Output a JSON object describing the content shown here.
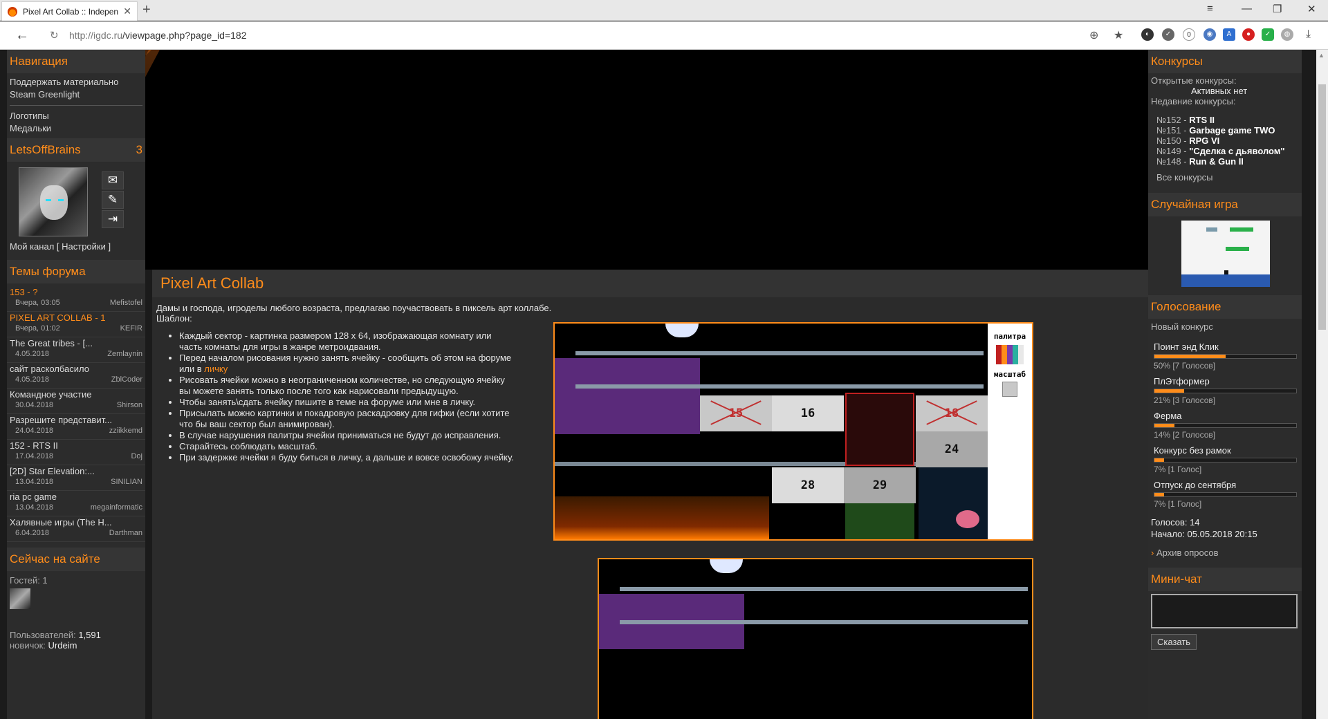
{
  "browser": {
    "tab_title": "Pixel Art Collab :: Indepen",
    "url_host": "http://igdc.ru",
    "url_path": "/viewpage.php?page_id=182",
    "ext_badge": "0"
  },
  "left": {
    "nav_title": "Навигация",
    "nav_links": [
      "Поддержать материально",
      "Steam Greenlight",
      "Логотипы",
      "Медальки"
    ],
    "user_name": "LetsOffBrains",
    "user_count": "3",
    "my_channel": "Мой канал",
    "settings": "[ Настройки ]",
    "forum_title": "Темы форума",
    "topics": [
      {
        "title": "153 - ?",
        "date": "Вчера, 03:05",
        "author": "Mefistofel",
        "hl": true
      },
      {
        "title": "PIXEL ART COLLAB - 1",
        "date": "Вчера, 01:02",
        "author": "KEFIR",
        "hl": true
      },
      {
        "title": "The Great tribes - [...",
        "date": "4.05.2018",
        "author": "Zemlaynin",
        "hl": false
      },
      {
        "title": "сайт расколбасило",
        "date": "4.05.2018",
        "author": "ZblCoder",
        "hl": false
      },
      {
        "title": "Командное участие",
        "date": "30.04.2018",
        "author": "Shirson",
        "hl": false
      },
      {
        "title": "Разрешите представит...",
        "date": "24.04.2018",
        "author": "zziikkemd",
        "hl": false
      },
      {
        "title": "152 - RTS II",
        "date": "17.04.2018",
        "author": "Doj",
        "hl": false
      },
      {
        "title": "[2D] Star Elevation:...",
        "date": "13.04.2018",
        "author": "SINILIAN",
        "hl": false
      },
      {
        "title": "ria pc game",
        "date": "13.04.2018",
        "author": "megainformatic",
        "hl": false
      },
      {
        "title": "Халявные игры (The H...",
        "date": "6.04.2018",
        "author": "Darthman",
        "hl": false
      }
    ],
    "online_title": "Сейчас на сайте",
    "guests": "Гостей: 1",
    "users_label": "Пользователей:",
    "users_count": "1,591",
    "newbie_label": "новичок:",
    "newbie_name": "Urdeim"
  },
  "main": {
    "title": "Pixel Art Collab",
    "intro1": "Дамы и господа, игроделы любого возраста, предлагаю поучаствовать в пиксель арт коллабе.",
    "intro2": "Шаблон:",
    "rules": [
      "Каждый сектор - картинка размером 128 x 64, изображающая комнату или часть комнаты для игры в жанре метроидвания.",
      "Перед началом рисования нужно занять ячейку - сообщить об этом на форуме или в ",
      "Рисовать ячейки можно в неограниченном количестве, но следующую ячейку вы можете занять только после того как нарисовали предыдущую.",
      "Чтобы занять\\сдать ячейку пишите в теме на форуме или мне в личку.",
      "Присылать можно картинки и покадровую раскадровку для гифки (если хотите что бы ваш сектор был анимирован).",
      "В случае нарушения палитры ячейки приниматься не будут до исправления.",
      "Старайтесь соблюдать масштаб.",
      "При задержке ячейки я буду биться в личку, а дальше и вовсе освобожу ячейку."
    ],
    "rule_link": "личку",
    "palette_label": "палитра",
    "scale_label": "масштаб",
    "cells": [
      "15",
      "16",
      "18",
      "24",
      "28",
      "29"
    ]
  },
  "right": {
    "contests_title": "Конкурсы",
    "open_label": "Открытые конкурсы:",
    "active_none": "Активных нет",
    "recent_label": "Недавние конкурсы:",
    "recent": [
      {
        "num": "№152 - ",
        "name": "RTS II"
      },
      {
        "num": "№151 - ",
        "name": "Garbage game TWO"
      },
      {
        "num": "№150 - ",
        "name": "RPG VI"
      },
      {
        "num": "№149 - ",
        "name": "\"Сделка с дьяволом\""
      },
      {
        "num": "№148 - ",
        "name": "Run & Gun II"
      }
    ],
    "all_contests": "Все конкурсы",
    "random_title": "Случайная игра",
    "poll_title": "Голосование",
    "poll_subtitle": "Новый конкурс",
    "poll": [
      {
        "q": "Поинт энд Клик",
        "pct": 50,
        "label": "50% [7 Голосов]"
      },
      {
        "q": "ПлЭтформер",
        "pct": 21,
        "label": "21% [3 Голосов]"
      },
      {
        "q": "Ферма",
        "pct": 14,
        "label": "14% [2 Голосов]"
      },
      {
        "q": "Конкурс без рамок",
        "pct": 7,
        "label": "7% [1 Голос]"
      },
      {
        "q": "Отпуск до сентября",
        "pct": 7,
        "label": "7% [1 Голос]"
      }
    ],
    "votes": "Голосов: 14",
    "start": "Начало: 05.05.2018 20:15",
    "archive": "Архив опросов",
    "chat_title": "Мини-чат",
    "say": "Сказать"
  }
}
